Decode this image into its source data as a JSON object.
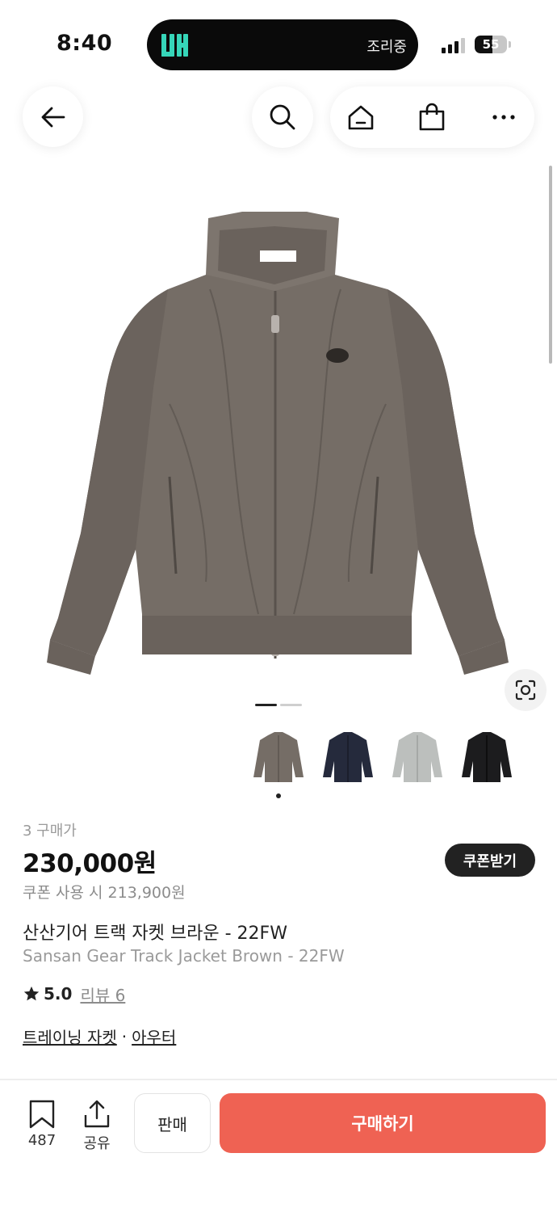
{
  "status_bar": {
    "time": "8:40",
    "island_app_logo": "app-logo",
    "island_status": "조리중",
    "battery_level": "55"
  },
  "nav": {
    "back_icon": "back-arrow-icon",
    "search_icon": "search-icon",
    "home_icon": "home-icon",
    "bag_icon": "shopping-bag-icon",
    "more_icon": "more-icon"
  },
  "gallery": {
    "current_slide": 1,
    "total_slides": 2,
    "thumbnails": [
      {
        "color_name": "brown",
        "color": "#756d66",
        "selected": true
      },
      {
        "color_name": "navy",
        "color": "#252a3c",
        "selected": false
      },
      {
        "color_name": "grey",
        "color": "#bcbfbd",
        "selected": false
      },
      {
        "color_name": "black",
        "color": "#1c1c1e",
        "selected": false
      }
    ],
    "image_colors": {
      "jacket": "#756d66",
      "jacket_shadow": "#5f5852",
      "jacket_light": "#857c75"
    }
  },
  "product": {
    "purchase_count": "3 구매가",
    "price": "230,000원",
    "coupon_price": "쿠폰 사용 시 213,900원",
    "coupon_button": "쿠폰받기",
    "title_ko": "산산기어 트랙 자켓 브라운 - 22FW",
    "title_en": "Sansan Gear Track Jacket Brown - 22FW",
    "rating": "5.0",
    "review_link": "리뷰 6",
    "category_1": "트레이닝 자켓",
    "category_sep": "·",
    "category_2": "아우터"
  },
  "bottom_bar": {
    "bookmark_count": "487",
    "share_label": "공유",
    "sell_label": "판매",
    "buy_label": "구매하기"
  },
  "colors": {
    "accent": "#ef6253",
    "text": "#222222",
    "muted": "#9a9a9a"
  }
}
